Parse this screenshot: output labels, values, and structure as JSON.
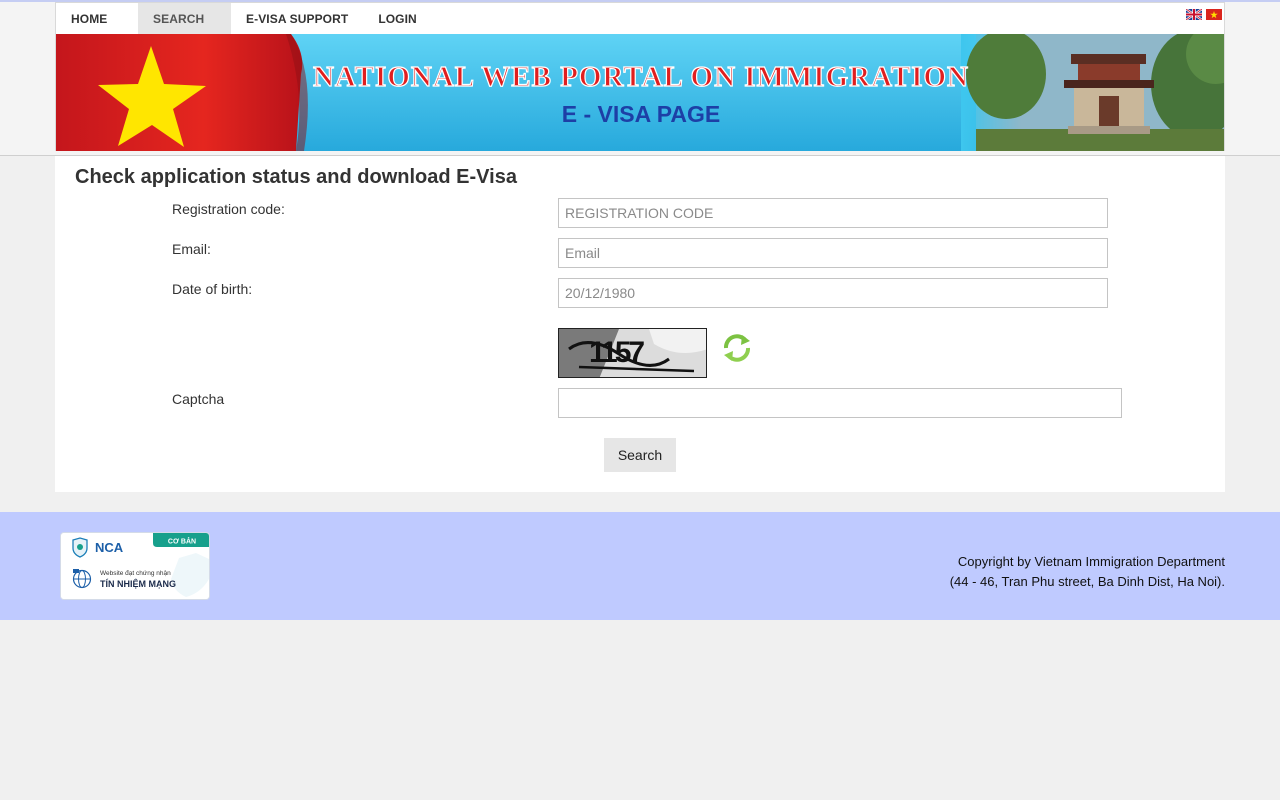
{
  "nav": {
    "items": [
      "HOME",
      "SEARCH",
      "E-VISA SUPPORT",
      "LOGIN"
    ],
    "active": "SEARCH"
  },
  "banner": {
    "title": "NATIONAL WEB PORTAL ON IMMIGRATION",
    "subtitle": "E - VISA PAGE"
  },
  "form": {
    "title": "Check application status and download E-Visa",
    "registration_label": "Registration code:",
    "registration_placeholder": "REGISTRATION CODE",
    "email_label": "Email:",
    "email_placeholder": "Email",
    "dob_label": "Date of birth:",
    "dob_placeholder": "20/12/1980",
    "captcha_label": "Captcha",
    "captcha_text": "1157",
    "search_label": "Search"
  },
  "footer": {
    "badge": {
      "brand": "NCA",
      "tier": "CƠ BẢN",
      "line1": "Website đạt chứng nhận",
      "line2": "TÍN NHIỆM MẠNG"
    },
    "copyright_line1": "Copyright by Vietnam Immigration Department",
    "copyright_line2": "(44 - 46, Tran Phu street, Ba Dinh Dist, Ha Noi)."
  },
  "colors": {
    "footer_bg": "#bfcaff",
    "banner_red": "#e2231a",
    "banner_sky": "#3ec6ee",
    "badge_teal": "#17a08c"
  }
}
